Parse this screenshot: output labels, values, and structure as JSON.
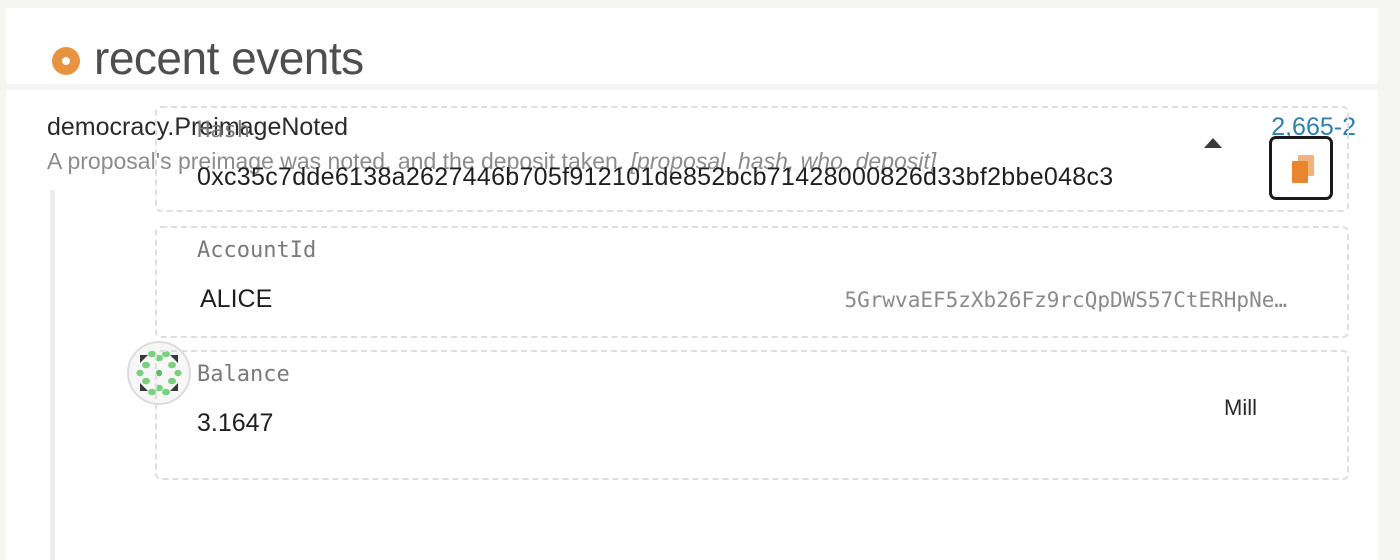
{
  "header": {
    "title": "recent events",
    "icon": "status-dot-icon",
    "accent_color": "#e8933f"
  },
  "event": {
    "name": "democracy.PreimageNoted",
    "description": "A proposal's preimage was noted, and the deposit taken.",
    "params": "[proposal_hash, who, deposit]",
    "block_ref": "2,665-2",
    "link_color": "#2f7fae",
    "toggle_icon": "caret-up-icon"
  },
  "fields": {
    "hash": {
      "label": "Hash",
      "value": "0xc35c7dde6138a2627446b705f912101de852bcb71428000826d33bf2bbe048c3",
      "copy_icon": "copy-icon"
    },
    "account": {
      "label": "AccountId",
      "name": "ALICE",
      "address": "5GrwvaEF5zXb26Fz9rcQpDWS57CtERHpNe…",
      "avatar_icon": "identicon-icon"
    },
    "balance": {
      "label": "Balance",
      "value": "3.1647",
      "unit": "Mill"
    }
  }
}
